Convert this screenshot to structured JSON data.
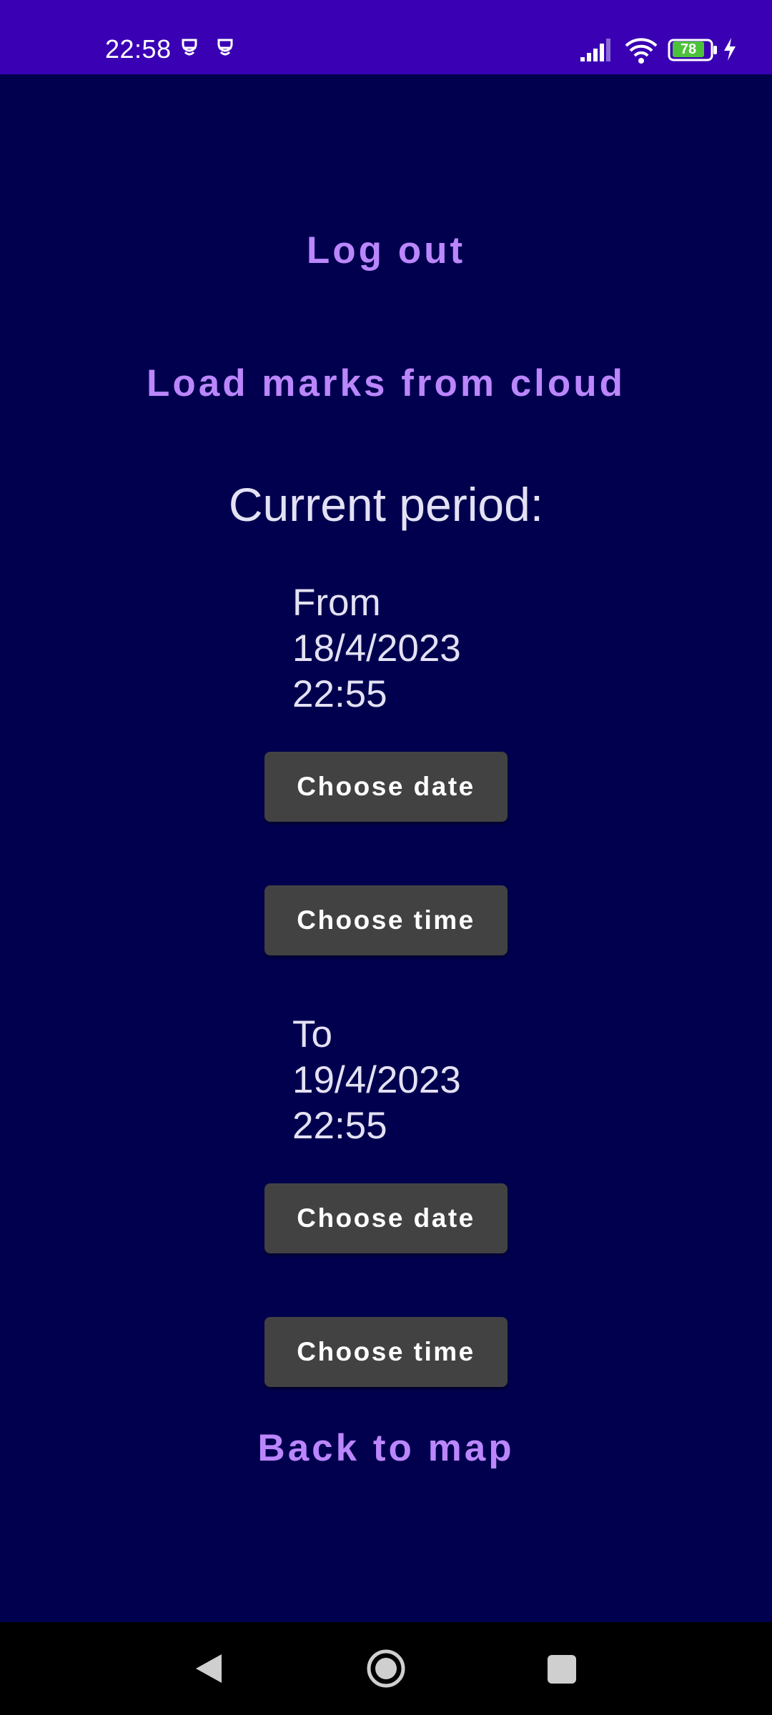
{
  "status_bar": {
    "time": "22:58",
    "battery_level": "78",
    "icons": [
      "notification-icon",
      "notification-icon",
      "signal-icon",
      "wifi-icon",
      "battery-icon",
      "charging-icon"
    ]
  },
  "account": {
    "logout_label": "Log out",
    "load_marks_label": "Load marks from cloud"
  },
  "period": {
    "title": "Current period:",
    "from": {
      "label": "From\n18/4/2023\n22:55",
      "choose_date_label": "Choose date",
      "choose_time_label": "Choose time"
    },
    "to": {
      "label": "To\n19/4/2023\n22:55",
      "choose_date_label": "Choose date",
      "choose_time_label": "Choose time"
    }
  },
  "navigation": {
    "back_to_map_label": "Back to map"
  },
  "colors": {
    "status_bar": "#3a00b4",
    "background": "#01004e",
    "accent": "#bb86fc",
    "button": "#424242",
    "text": "#e3e1f4"
  }
}
